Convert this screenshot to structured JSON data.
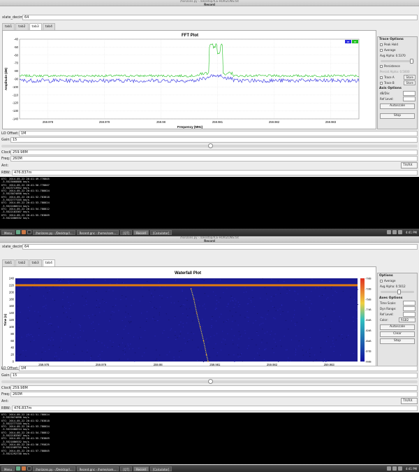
{
  "window_title": "/horizons.py - /Desktop/ICE-HORIZONS.txt",
  "window_subtitle": "Record",
  "decim": {
    "label": "xlate_decim:",
    "value": "64"
  },
  "tabs": [
    "tab1",
    "tab2",
    "tab3",
    "tab4"
  ],
  "fft": {
    "title": "FFT Plot",
    "xlabel": "Frequency (MHz)",
    "ylabel": "Amplitude (dB)",
    "legend": [
      "ffff",
      "ffff"
    ],
    "options": {
      "header": "Trace Options",
      "peak_hold": "Peak Hold",
      "average": "Average",
      "avg_alpha": "Avg Alpha: 0.5370",
      "persistence": "Persistence",
      "persist_alpha": "Persist Alpha: 0.5000",
      "trace_a": "Trace A",
      "trace_b": "Trace B",
      "store": "Store",
      "axis_header": "Axis Options",
      "db_div": "dB/Div:",
      "ref_level": "Ref Level:",
      "autoscale": "Autoscale",
      "stop": "Stop"
    }
  },
  "waterfall": {
    "title": "Waterfall Plot",
    "xlabel": "Frequency (MHz)",
    "ylabel": "Time (s)",
    "options": {
      "header": "Options",
      "average": "Average",
      "avg_alpha": "Avg Alpha: 0.5012",
      "axis_header": "Axes Options",
      "time_scale": "Time Scale:",
      "dyn_range": "Dyn Range:",
      "ref_level": "Ref Level:",
      "color_label": "Color:",
      "color_value": "RGB2",
      "autoscale": "Autoscale",
      "clear": "Clear",
      "stop": "Stop"
    },
    "colorbar_labels": [
      "-70dB",
      "-72dB",
      "-75dB",
      "-77dB",
      "-80dB",
      "-82dB",
      "-85dB",
      "-87dB",
      "-90dB"
    ]
  },
  "controls": {
    "lo_offset": {
      "label": "LO Offset:",
      "value": "1M"
    },
    "gain": {
      "label": "Gain:",
      "value": "15"
    },
    "clock": {
      "label": "Clock:",
      "value": "259.98M"
    },
    "freq": {
      "label": "Freq:",
      "value": "260M"
    },
    "ant": {
      "label": "Ant:",
      "value": "TX/RX"
    },
    "rbw": {
      "label": "RBW:",
      "value": "476.837m"
    }
  },
  "terminal1": [
    "UTC: 2014-05-22 20:41:49.778805",
    ".3.5523068888 km/s",
    "UTC: 2014-05-22 20:41:50.778807",
    ".3.5523713952 km/s",
    "UTC: 2014-05-22 20:41:51.788024",
    ".3.5523074698 km/s",
    "UTC: 2014-05-22 20:41:52.783818",
    ".3.5522777155 km/s",
    "UTC: 2014-05-22 20:41:53.788024",
    ".3.5522480214 km/s",
    "UTC: 2014-05-22 20:41:54.788812",
    ".3.5522183367 km/s",
    "UTC: 2014-05-22 20:41:55.783809",
    ".3.5521886532 km/s"
  ],
  "terminal2": [
    "UTC: 2014-05-22 20:41:51.788024",
    ".3.5523074698 km/s",
    "UTC: 2014-05-22 20:41:52.783818",
    ".3.5522777155 km/s",
    "UTC: 2014-05-22 20:41:53.788024",
    ".3.5522480214 km/s",
    "UTC: 2014-05-22 20:41:54.788812",
    ".3.5522183367 km/s",
    "UTC: 2014-05-22 20:41:55.783809",
    ".3.5521886532 km/s",
    "UTC: 2014-05-22 20:41:56.795829",
    ".3.5521589755 km/s",
    "UTC: 2014-05-22 20:41:57.788805",
    ".3.5521292738 km/s"
  ],
  "taskbar": {
    "menu": "Menu",
    "items": [
      "/horizons.py - /Desktop/I...",
      "Recent.gnc - /home/sam...",
      "[QT]",
      "Record",
      "[Calculator]"
    ],
    "clock": "4:41 PM"
  },
  "chart_data": [
    {
      "type": "line",
      "title": "FFT Plot",
      "xlabel": "Frequency (MHz)",
      "ylabel": "Amplitude (dB)",
      "xlim": [
        259.9775,
        259.9835
      ],
      "ylim": [
        -140,
        -40
      ],
      "xticks": [
        "259.978",
        "259.979",
        "259.98",
        "259.981",
        "259.982",
        "259.983"
      ],
      "yticks": [
        -40,
        -50,
        -60,
        -70,
        -80,
        -90,
        -100,
        -110,
        -120,
        -130,
        -140
      ],
      "grid": true,
      "legend_position": "top-right",
      "series": [
        {
          "color": "#1fc01f",
          "noise_floor": -86,
          "peak": -52,
          "peak_range": [
            259.98085,
            259.9811
          ]
        },
        {
          "color": "#2d2de0",
          "noise_floor": -92,
          "peak": -86,
          "peak_range": [
            259.98085,
            259.9811
          ]
        }
      ]
    },
    {
      "type": "heatmap",
      "title": "Waterfall Plot",
      "xlabel": "Frequency (MHz)",
      "ylabel": "Time (s)",
      "xlim": [
        259.9775,
        259.9835
      ],
      "ylim": [
        0,
        240
      ],
      "xticks": [
        "259.978",
        "259.979",
        "259.98",
        "259.981",
        "259.982",
        "259.983"
      ],
      "yticks": [
        0,
        20,
        40,
        60,
        80,
        100,
        120,
        140,
        160,
        180,
        200,
        220,
        240
      ],
      "colorbar": {
        "min_db": -90,
        "max_db": -70
      },
      "signal_track": [
        {
          "t": 210,
          "f": 259.98058
        },
        {
          "t": 180,
          "f": 259.98063
        },
        {
          "t": 140,
          "f": 259.98068
        },
        {
          "t": 100,
          "f": 259.98074
        },
        {
          "t": 60,
          "f": 259.9808
        },
        {
          "t": 20,
          "f": 259.98085
        },
        {
          "t": 0,
          "f": 259.98088
        }
      ],
      "band_time": 220
    }
  ]
}
